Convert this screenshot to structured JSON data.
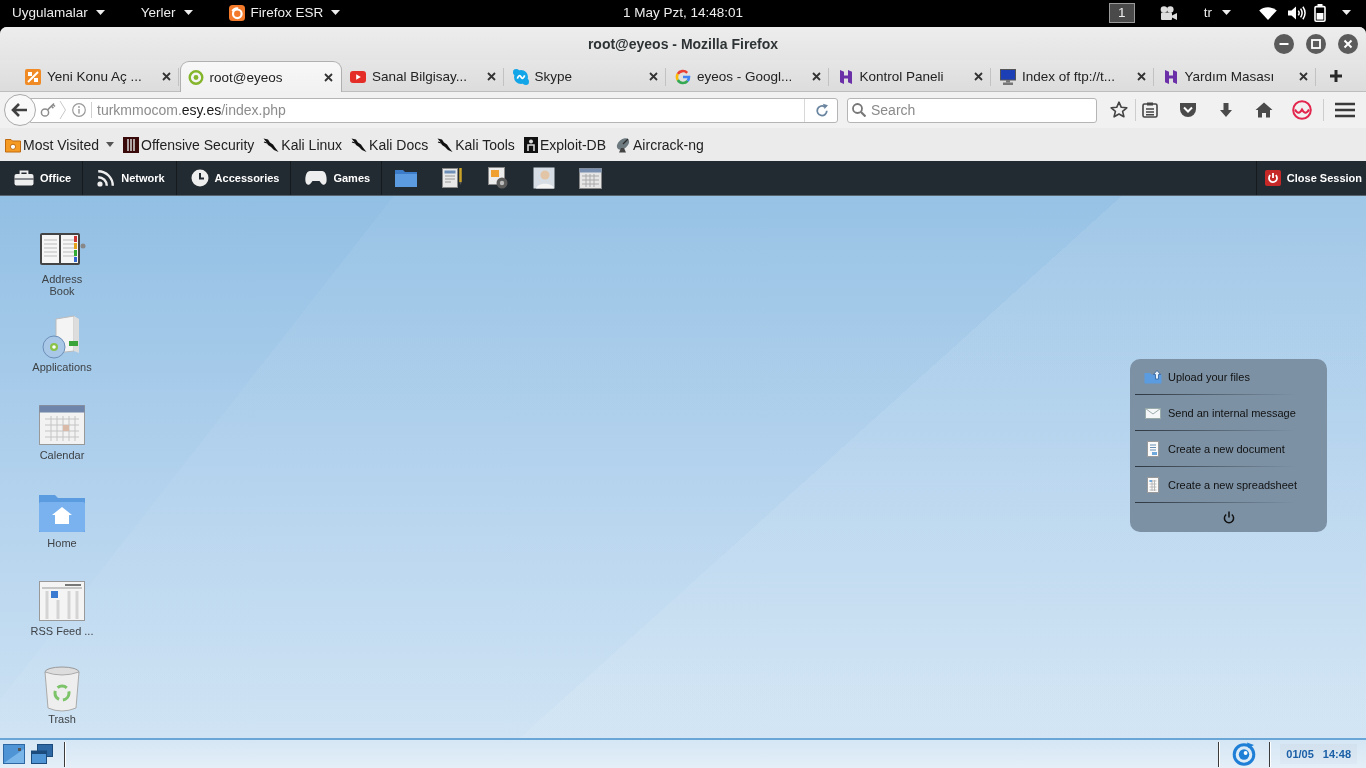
{
  "top_bar": {
    "menus": [
      {
        "label": "Uygulamalar",
        "kind": "plain"
      },
      {
        "label": "Yerler",
        "kind": "plain"
      },
      {
        "label": "Firefox ESR",
        "kind": "app"
      }
    ],
    "clock": "1 May Pzt, 14:48:01",
    "workspace": "1",
    "keyboard_layout": "tr"
  },
  "window": {
    "title": "root@eyeos - Mozilla Firefox"
  },
  "tabs": [
    {
      "label": "Yeni Konu Aç ...",
      "kind": "tile",
      "selected": false
    },
    {
      "label": "root@eyeos",
      "kind": "ring",
      "selected": true
    },
    {
      "label": "Sanal Bilgisay...",
      "kind": "play",
      "selected": false
    },
    {
      "label": "Skype",
      "kind": "bubble",
      "selected": false
    },
    {
      "label": "eyeos - Googl...",
      "kind": "segments",
      "selected": false
    },
    {
      "label": "Kontrol Paneli",
      "kind": "castle",
      "selected": false
    },
    {
      "label": "Index of ftp://t...",
      "kind": "monitor",
      "selected": false
    },
    {
      "label": "Yardım Masası",
      "kind": "castle",
      "selected": false
    }
  ],
  "address_bar": {
    "url_parts": [
      {
        "text": "turkmmocom.",
        "kind": "host"
      },
      {
        "text": "esy.es",
        "kind": "domain"
      },
      {
        "text": "/index.php",
        "kind": "path"
      }
    ]
  },
  "search": {
    "placeholder": "Search"
  },
  "bookmarks": [
    {
      "label": "Most Visited",
      "kind": "folder"
    },
    {
      "label": "Offensive Security",
      "kind": "tile"
    },
    {
      "label": "Kali Linux",
      "kind": "dragon"
    },
    {
      "label": "Kali Docs",
      "kind": "dragon"
    },
    {
      "label": "Kali Tools",
      "kind": "dragon"
    },
    {
      "label": "Exploit-DB",
      "kind": "figure"
    },
    {
      "label": "Aircrack-ng",
      "kind": "dish"
    }
  ],
  "eyeos_menu": [
    {
      "label": "Office",
      "kind": "briefcase"
    },
    {
      "label": "Network",
      "kind": "feed"
    },
    {
      "label": "Accessories",
      "kind": "clock"
    },
    {
      "label": "Games",
      "kind": "gamepad"
    }
  ],
  "close_session": "Close Session",
  "desktop_icons": [
    {
      "label": "Address Book",
      "kind": "notebook"
    },
    {
      "label": "Applications",
      "kind": "software"
    },
    {
      "label": "Calendar",
      "kind": "calendar"
    },
    {
      "label": "Home",
      "kind": "home"
    },
    {
      "label": "RSS Feed ...",
      "kind": "newspaper"
    },
    {
      "label": "Trash",
      "kind": "trash"
    }
  ],
  "quick_actions": [
    {
      "label": "Upload your files",
      "kind": "upload"
    },
    {
      "label": "Send an internal message",
      "kind": "message"
    },
    {
      "label": "Create a new document",
      "kind": "document"
    },
    {
      "label": "Create a new spreadsheet",
      "kind": "spreadsheet"
    }
  ],
  "taskbar": {
    "date": "01/05",
    "time": "14:48"
  }
}
